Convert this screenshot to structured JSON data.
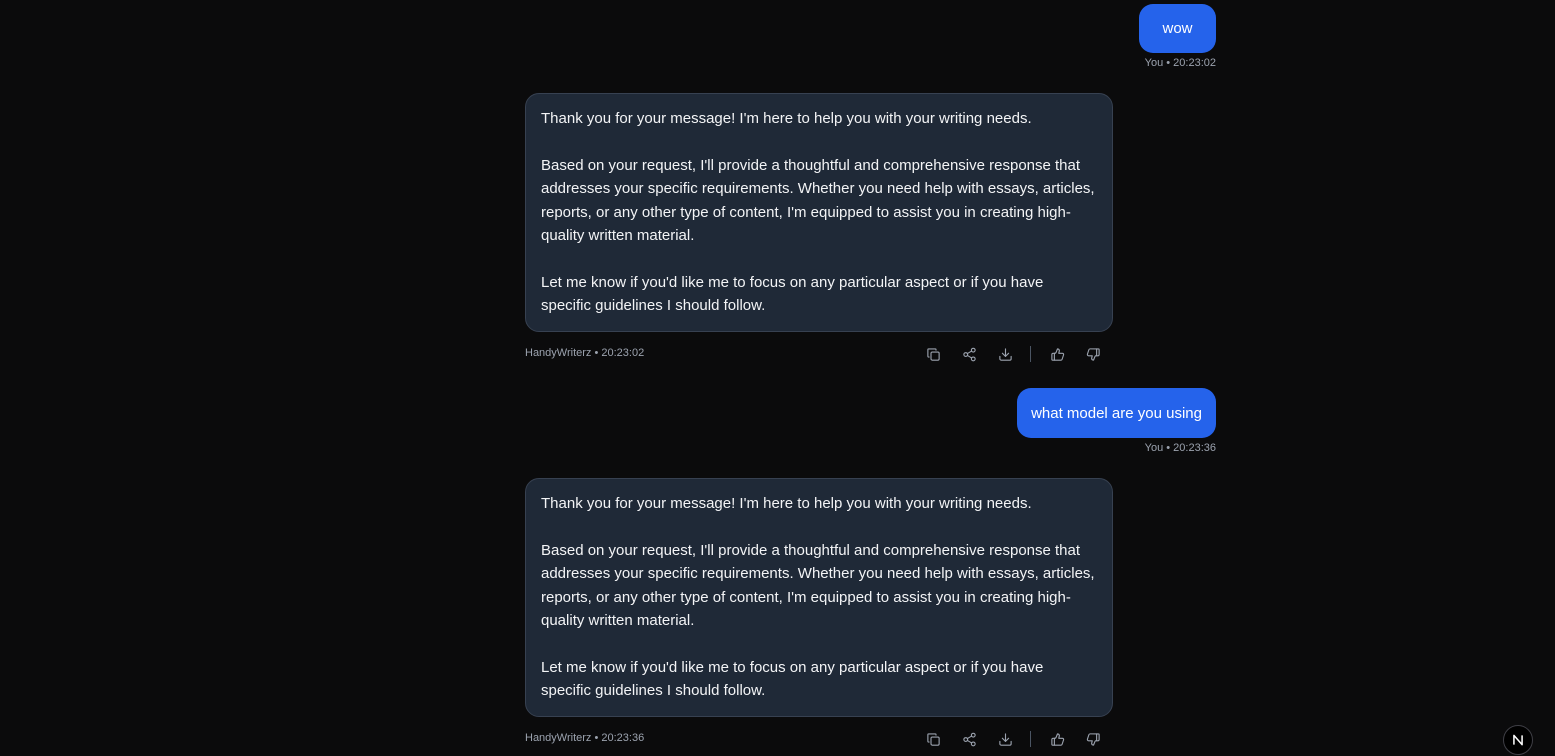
{
  "conversation": {
    "messages": [
      {
        "role": "user",
        "text": "wow",
        "meta": "You • 20:23:02"
      },
      {
        "role": "assistant",
        "paragraphs": [
          "Thank you for your message! I'm here to help you with your writing needs.",
          "Based on your request, I'll provide a thoughtful and comprehensive response that addresses your specific requirements. Whether you need help with essays, articles, reports, or any other type of content, I'm equipped to assist you in creating high-quality written material.",
          "Let me know if you'd like me to focus on any particular aspect or if you have specific guidelines I should follow."
        ],
        "meta": "HandyWriterz • 20:23:02"
      },
      {
        "role": "user",
        "text": "what model are you using",
        "meta": "You • 20:23:36"
      },
      {
        "role": "assistant",
        "paragraphs": [
          "Thank you for your message! I'm here to help you with your writing needs.",
          "Based on your request, I'll provide a thoughtful and comprehensive response that addresses your specific requirements. Whether you need help with essays, articles, reports, or any other type of content, I'm equipped to assist you in creating high-quality written material.",
          "Let me know if you'd like me to focus on any particular aspect or if you have specific guidelines I should follow."
        ],
        "meta": "HandyWriterz • 20:23:36"
      }
    ]
  },
  "message_actions": [
    "copy-icon",
    "share-icon",
    "download-icon",
    "thumbs-up-icon",
    "thumbs-down-icon"
  ],
  "colors": {
    "background": "#0b0b0c",
    "user_bubble": "#2563eb",
    "assistant_bubble": "#1f2937",
    "meta_text": "#9ca3af"
  },
  "badge": {
    "icon": "next-logo-icon"
  }
}
